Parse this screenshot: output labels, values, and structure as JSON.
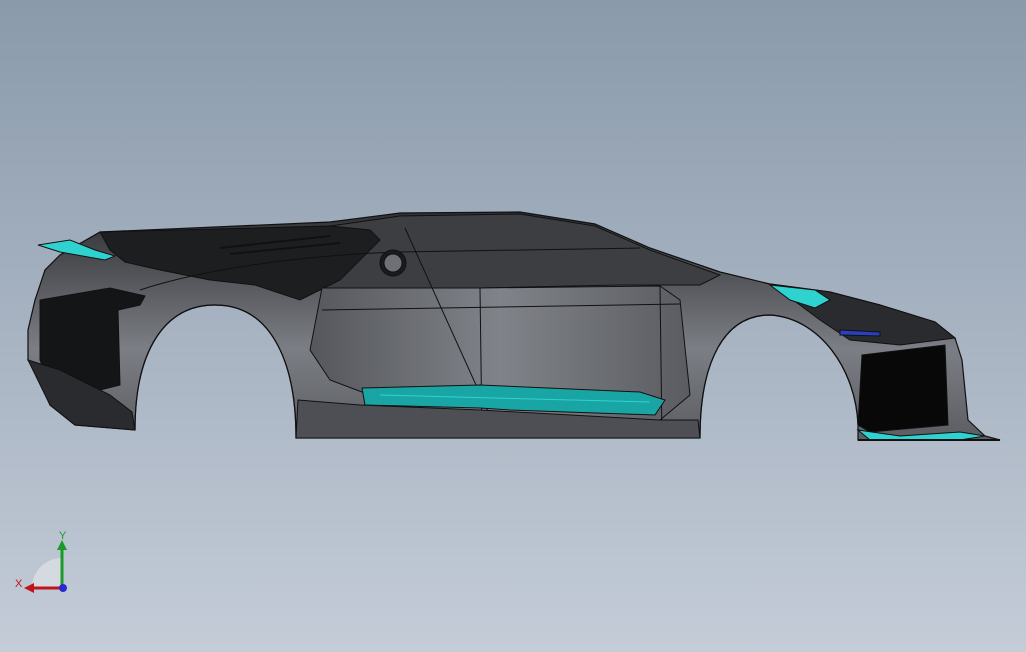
{
  "viewport": {
    "background_top": "#8a9aab",
    "background_bottom": "#c4ccd8"
  },
  "model": {
    "body_color": "#5b5d62",
    "body_light": "#7b7e84",
    "body_dark": "#2f3134",
    "edge_color": "#111111",
    "glass_color": "#3c3e42",
    "accent_color": "#1aa5a5",
    "accent_light": "#2ed3d0",
    "accent_blue": "#2a3fc0"
  },
  "triad": {
    "x_label": "X",
    "y_label": "Y",
    "x_color": "#c0141b",
    "y_color": "#1a9a2a",
    "z_color": "#2a2ad0"
  }
}
